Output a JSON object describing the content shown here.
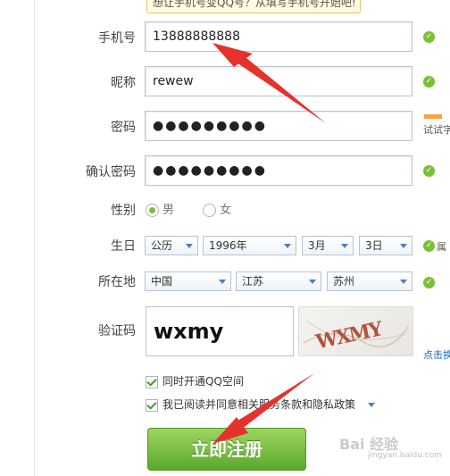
{
  "tooltip": "想让手机号变QQ号？从填写手机号开始吧!",
  "fields": {
    "phone": {
      "label": "手机号",
      "value": "13888888888"
    },
    "nickname": {
      "label": "昵称",
      "value": "rewew"
    },
    "password": {
      "label": "密码",
      "value": "●●●●●●●●●"
    },
    "confirm": {
      "label": "确认密码",
      "value": "●●●●●●●●●"
    }
  },
  "gender": {
    "label": "性别",
    "male": "男",
    "female": "女",
    "selected": "male"
  },
  "birthday": {
    "label": "生日",
    "calendar": "公历",
    "year": "1996年",
    "month": "3月",
    "day": "3日"
  },
  "location": {
    "label": "所在地",
    "country": "中国",
    "province": "江苏",
    "city": "苏州"
  },
  "captcha": {
    "label": "验证码",
    "value": "wxmy",
    "image_text": "WXMY",
    "refresh_link": "点击换"
  },
  "right_snippets": {
    "password_hint": "试试字",
    "birthday_hint": "属"
  },
  "checks": {
    "qzone": "同时开通QQ空间",
    "terms": "我已阅读并同意相关服务条款和隐私政策"
  },
  "submit_label": "立即注册",
  "watermark": {
    "brand": "Bai 经验",
    "url": "jingyan.baidu.com"
  },
  "colors": {
    "accent": "#7cbf35",
    "arrow": "#e6322d",
    "link": "#1e66b4"
  }
}
